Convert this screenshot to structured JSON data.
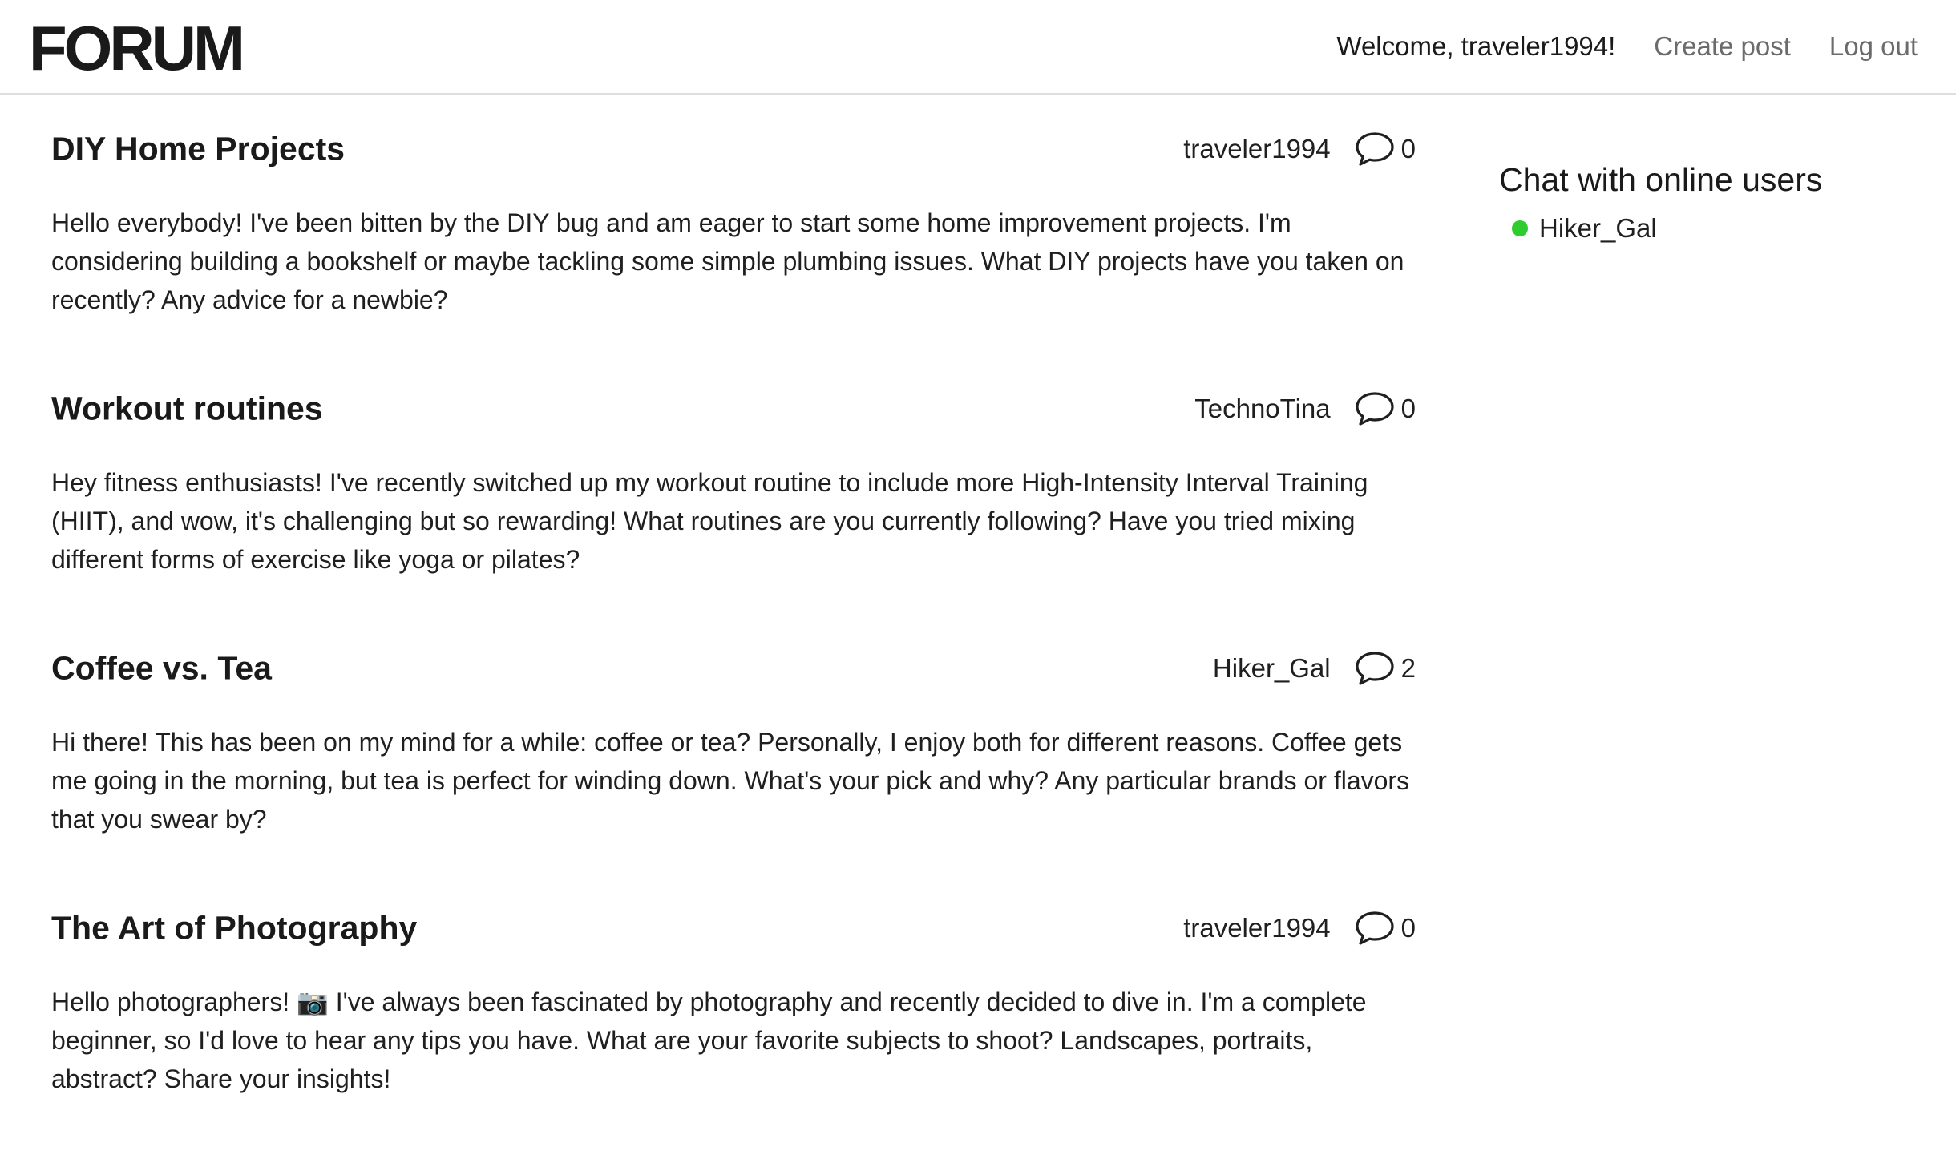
{
  "header": {
    "logo": "FORUM",
    "welcome": "Welcome, traveler1994!",
    "create_post": "Create post",
    "log_out": "Log out"
  },
  "posts": [
    {
      "title": "DIY Home Projects",
      "author": "traveler1994",
      "comment_count": "0",
      "body": "Hello everybody! I've been bitten by the DIY bug and am eager to start some home improvement projects. I'm considering building a bookshelf or maybe tackling some simple plumbing issues. What DIY projects have you taken on recently? Any advice for a newbie?"
    },
    {
      "title": "Workout routines",
      "author": "TechnoTina",
      "comment_count": "0",
      "body": "Hey fitness enthusiasts! I've recently switched up my workout routine to include more High-Intensity Interval Training (HIIT), and wow, it's challenging but so rewarding! What routines are you currently following? Have you tried mixing different forms of exercise like yoga or pilates?"
    },
    {
      "title": "Coffee vs. Tea",
      "author": "Hiker_Gal",
      "comment_count": "2",
      "body": "Hi there! This has been on my mind for a while: coffee or tea? Personally, I enjoy both for different reasons. Coffee gets me going in the morning, but tea is perfect for winding down. What's your pick and why? Any particular brands or flavors that you swear by?"
    },
    {
      "title": "The Art of Photography",
      "author": "traveler1994",
      "comment_count": "0",
      "body": "Hello photographers! 📷 I've always been fascinated by photography and recently decided to dive in. I'm a complete beginner, so I'd love to hear any tips you have. What are your favorite subjects to shoot? Landscapes, portraits, abstract? Share your insights!"
    }
  ],
  "sidebar": {
    "title": "Chat with online users",
    "online_users": [
      {
        "name": "Hiker_Gal",
        "status_color": "#2ecc2e"
      }
    ]
  },
  "icons": {
    "comment": "speech-bubble-icon",
    "status": "online-dot-icon"
  }
}
